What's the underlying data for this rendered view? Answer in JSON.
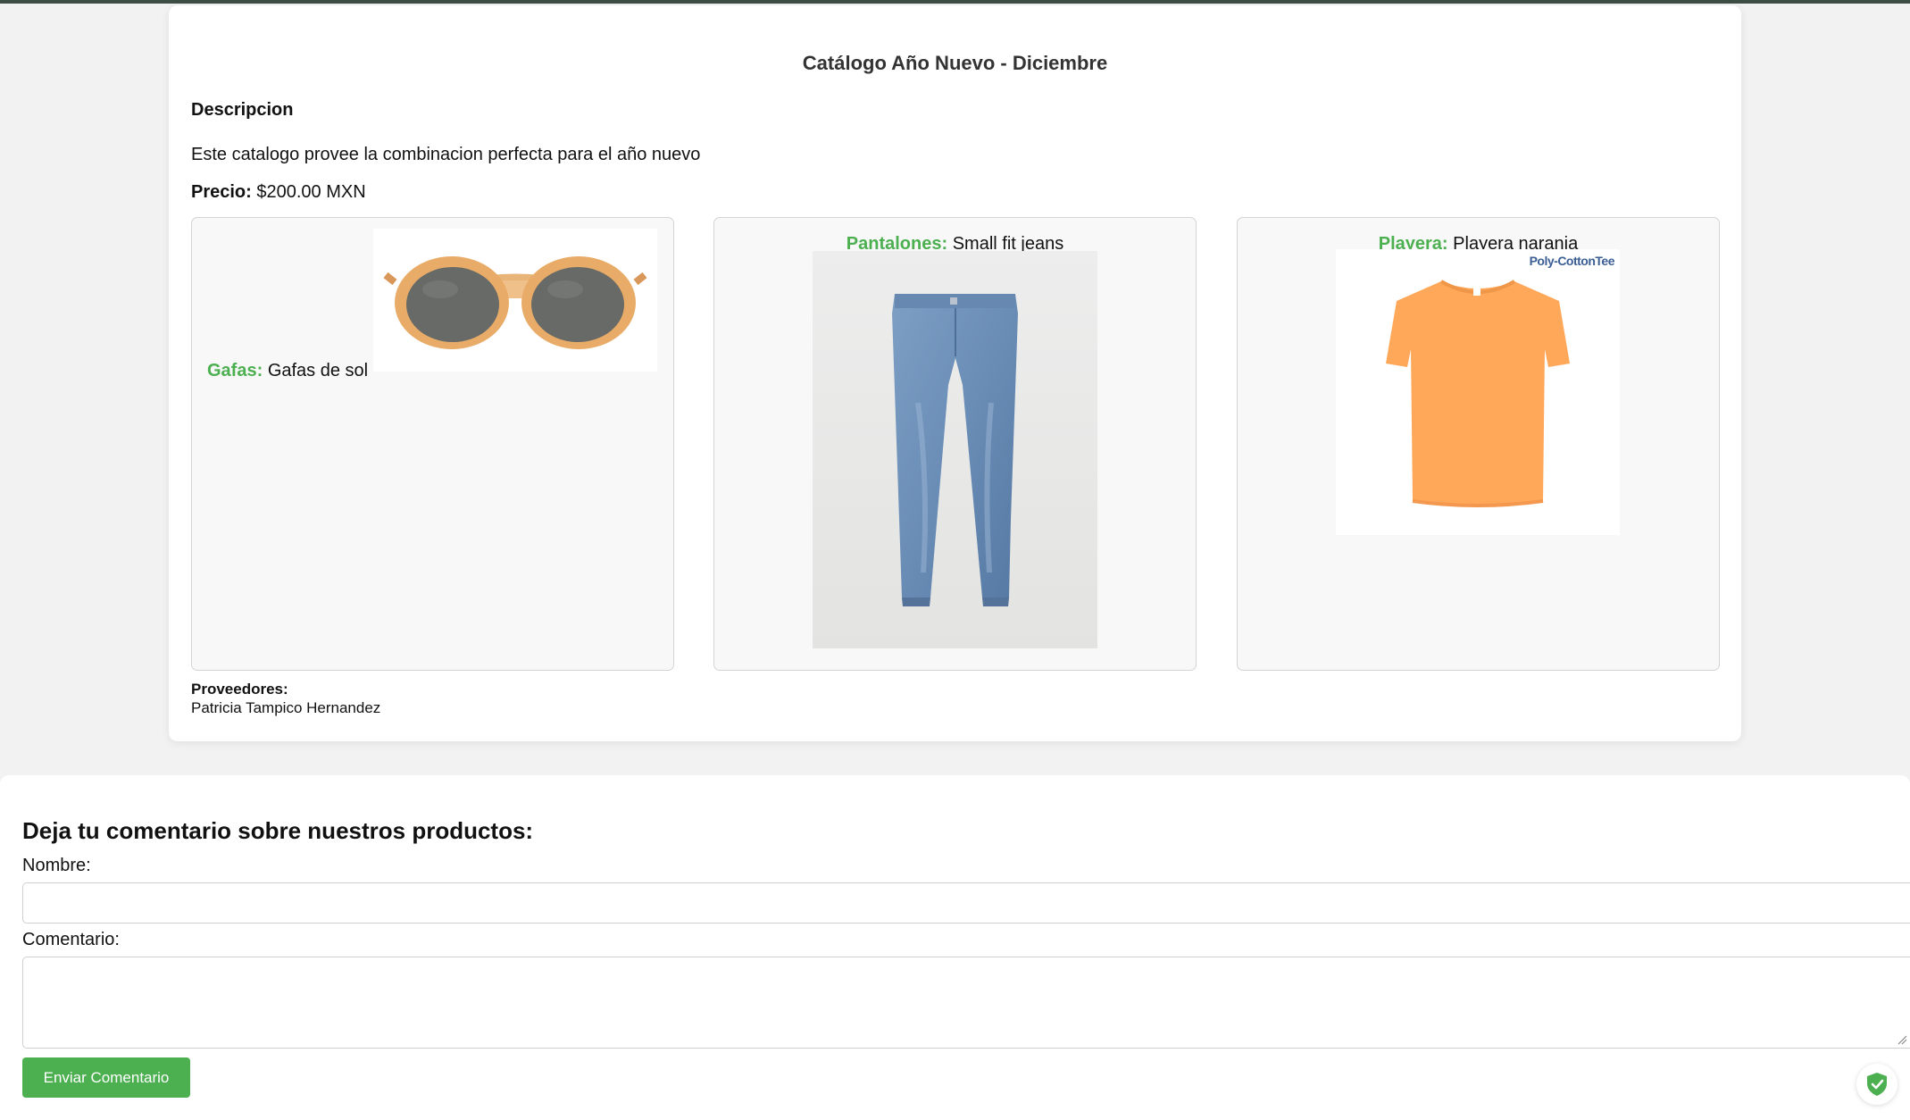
{
  "catalog": {
    "title": "Catálogo Año Nuevo - Diciembre",
    "description_heading": "Descripcion",
    "description": "Este catalogo provee la combinacion perfecta para el año nuevo",
    "price_label": "Precio:",
    "price_value": "$200.00 MXN",
    "products": [
      {
        "category": "Gafas:",
        "name": "Gafas de sol",
        "image": "sunglasses-image"
      },
      {
        "category": "Pantalones:",
        "name": "Small fit jeans",
        "image": "jeans-image"
      },
      {
        "category": "Playera:",
        "name": "Playera naranja",
        "image": "orange-tshirt-image",
        "image_brand_text": "Poly-CottonTee"
      }
    ],
    "vendors_label": "Proveedores:",
    "vendors": [
      "Patricia Tampico Hernandez"
    ]
  },
  "comment_form": {
    "heading": "Deja tu comentario sobre nuestros productos:",
    "name_label": "Nombre:",
    "name_value": "",
    "comment_label": "Comentario:",
    "comment_value": "",
    "submit_label": "Enviar Comentario"
  },
  "colors": {
    "accent_green": "#4caf50",
    "background": "#f2f2f2",
    "card": "#ffffff"
  },
  "icons": {
    "security_badge": "shield-check-icon"
  }
}
